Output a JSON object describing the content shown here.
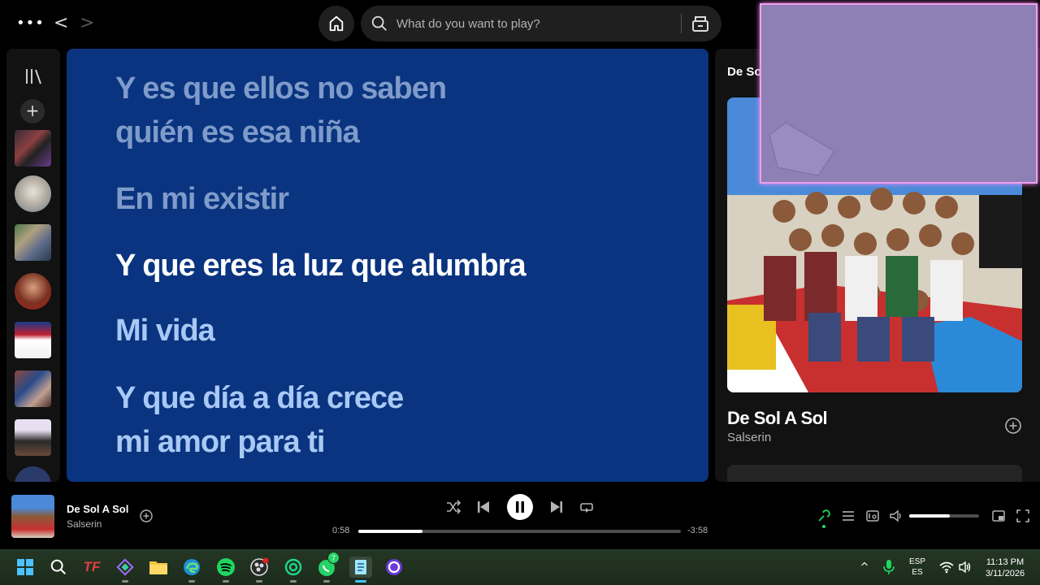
{
  "topbar": {
    "search_placeholder": "What do you want to play?"
  },
  "lyrics": {
    "past": [
      "Y es que ellos no saben",
      "quién es esa niña",
      "En mi existir"
    ],
    "current": "Y que eres la luz que alumbra",
    "future": [
      "Mi vida",
      "Y que día a día crece",
      "mi amor para ti"
    ]
  },
  "right_panel": {
    "header": "De Sol A Sol",
    "song_title": "De Sol A Sol",
    "artist": "Salserin"
  },
  "now_playing": {
    "title": "De Sol A Sol",
    "artist": "Salserin",
    "elapsed": "0:58",
    "remaining": "-3:58",
    "progress_fraction": 0.2,
    "volume_fraction": 0.58,
    "is_playing": true
  },
  "taskbar": {
    "whatsapp_badge": "7",
    "lang_top": "ESP",
    "lang_bottom": "ES",
    "time": "11:13 PM",
    "date": "3/11/2026"
  },
  "colors": {
    "lyrics_bg": "#0a3480",
    "spotify_green": "#1ed760",
    "pip_border": "#f0a0ec"
  }
}
